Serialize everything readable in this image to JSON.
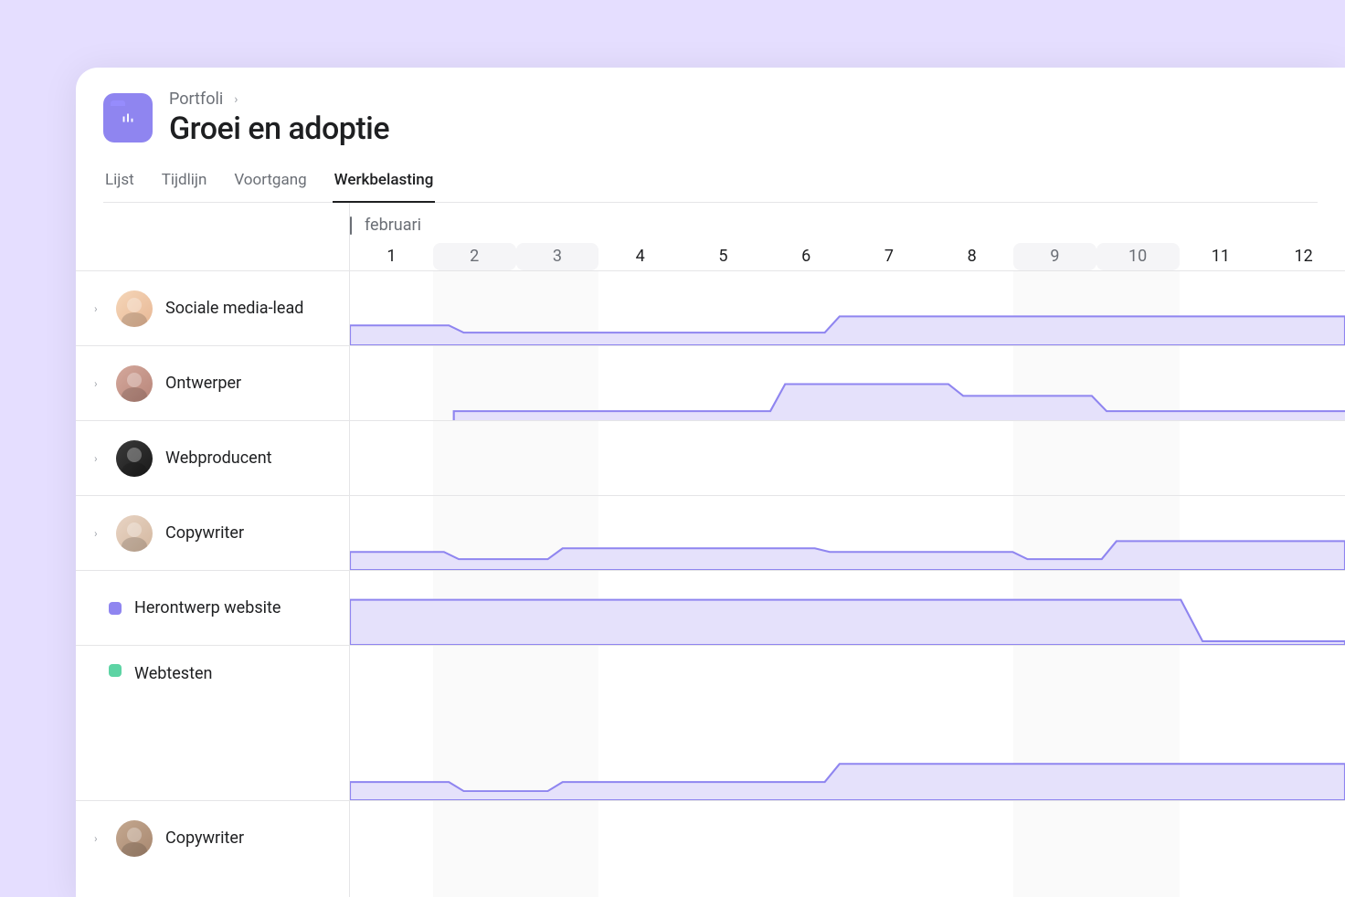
{
  "breadcrumb": {
    "parent": "Portfoli"
  },
  "page_title": "Groei en adoptie",
  "tabs": [
    {
      "label": "Lijst",
      "active": false
    },
    {
      "label": "Tijdlijn",
      "active": false
    },
    {
      "label": "Voortgang",
      "active": false
    },
    {
      "label": "Werkbelasting",
      "active": true
    }
  ],
  "timeline": {
    "month": "februari",
    "days": [
      1,
      2,
      3,
      4,
      5,
      6,
      7,
      8,
      9,
      10,
      11,
      12
    ],
    "weekends": [
      [
        2,
        3
      ],
      [
        9,
        10
      ]
    ]
  },
  "resources": [
    {
      "name": "Sociale media-lead",
      "type": "person",
      "avatar": "a1",
      "expandable": true
    },
    {
      "name": "Ontwerper",
      "type": "person",
      "avatar": "a2",
      "expandable": true
    },
    {
      "name": "Webproducent",
      "type": "person",
      "avatar": "a3",
      "expandable": true
    },
    {
      "name": "Copywriter",
      "type": "person",
      "avatar": "a4",
      "expandable": true
    },
    {
      "name": "Herontwerp website",
      "type": "project",
      "color": "purple",
      "expandable": false
    },
    {
      "name": "Webtesten",
      "type": "project",
      "color": "green",
      "expandable": false
    },
    {
      "name": "Copywriter",
      "type": "person",
      "avatar": "a5",
      "expandable": true
    }
  ]
}
